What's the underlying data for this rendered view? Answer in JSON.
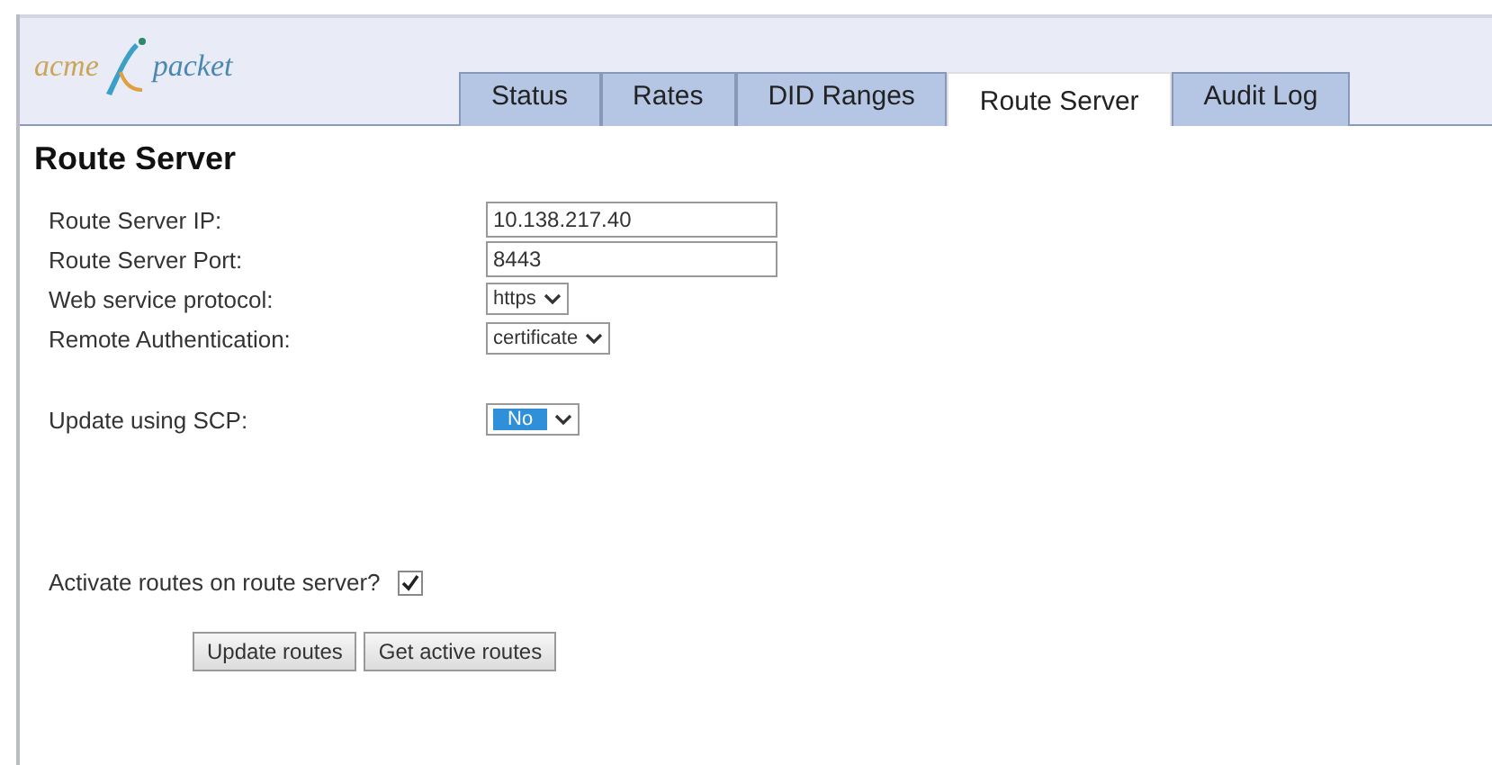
{
  "logo": {
    "left": "acme",
    "right": "packet"
  },
  "tabs": [
    {
      "label": "Status",
      "selected": false
    },
    {
      "label": "Rates",
      "selected": false
    },
    {
      "label": "DID Ranges",
      "selected": false
    },
    {
      "label": "Route Server",
      "selected": true
    },
    {
      "label": "Audit Log",
      "selected": false
    }
  ],
  "title": "Route Server",
  "fields": [
    {
      "kind": "text",
      "label": "Route Server IP:",
      "value": "10.138.217.40"
    },
    {
      "kind": "text",
      "label": "Route Server Port:",
      "value": "8443"
    },
    {
      "kind": "select",
      "label": "Web service protocol:",
      "value": "https",
      "focused": false
    },
    {
      "kind": "select",
      "label": "Remote Authentication:",
      "value": "certificate",
      "focused": false
    },
    {
      "kind": "select",
      "label": "Update using SCP:",
      "value": "No",
      "focused": true
    }
  ],
  "activate": {
    "label": "Activate routes on route server?",
    "checked": true
  },
  "buttons": [
    "Update routes",
    "Get active routes"
  ]
}
